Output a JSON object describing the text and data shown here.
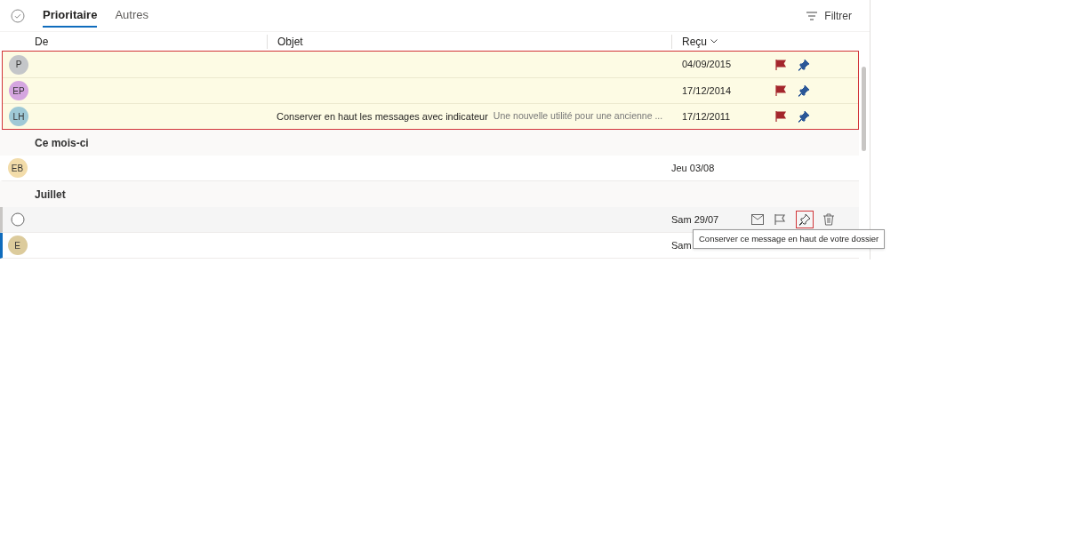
{
  "tabs": [
    {
      "label": "Prioritaire",
      "selected": true
    },
    {
      "label": "Autres",
      "selected": false
    }
  ],
  "filter": {
    "label": "Filtrer"
  },
  "columns": {
    "from": "De",
    "subject": "Objet",
    "received": "Reçu"
  },
  "pinned": [
    {
      "initials": "P",
      "color": "#c4c6c9",
      "date": "04/09/2015",
      "flagged": true,
      "pinned": true
    },
    {
      "initials": "EP",
      "color": "#d5a6e0",
      "date": "17/12/2014",
      "flagged": true,
      "pinned": true
    },
    {
      "initials": "LH",
      "color": "#9fc9d6",
      "subject": "Conserver en haut les messages avec indicateur",
      "preview": "Une nouvelle utilité pour une ancienne ...",
      "date": "17/12/2011",
      "flagged": true,
      "pinned": true
    }
  ],
  "groups": [
    {
      "title": "Ce mois-ci",
      "rows": [
        {
          "kind": "avatar",
          "initials": "EB",
          "color": "#f2dcaa",
          "date": "Jeu 03/08",
          "unread": false,
          "hovered": false
        }
      ]
    },
    {
      "title": "Juillet",
      "rows": [
        {
          "kind": "select",
          "date": "Sam 29/07",
          "unread": false,
          "hovered": true
        },
        {
          "kind": "avatar",
          "initials": "E",
          "color": "#dccb9c",
          "date": "Sam",
          "unread": true,
          "hovered": false
        }
      ]
    }
  ],
  "tooltip": "Conserver ce message en haut de votre dossier"
}
